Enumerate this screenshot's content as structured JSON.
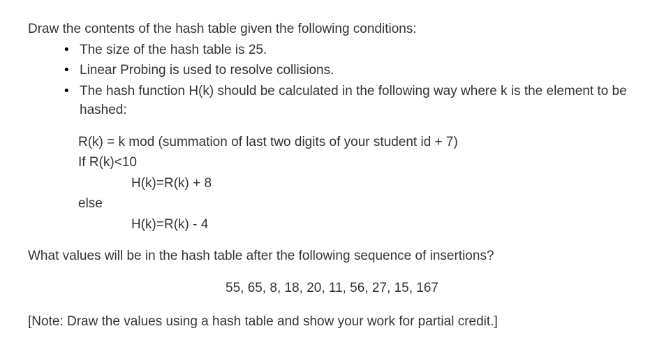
{
  "intro": "Draw the contents of the hash table given the following conditions:",
  "bullets": [
    "The size of the hash table is 25.",
    "Linear Probing is used to resolve collisions.",
    "The hash function H(k) should be calculated in the following way where k is the element to be hashed:"
  ],
  "formula": {
    "line1": "R(k) = k mod (summation of last two digits of your student id + 7)",
    "line2": "If R(k)<10",
    "line3": "H(k)=R(k) + 8",
    "line4": "else",
    "line5": "H(k)=R(k) - 4"
  },
  "question": "What values will be in the hash table after the following sequence of insertions?",
  "sequence": "55, 65, 8, 18, 20, 11, 56, 27, 15, 167",
  "note": "[Note: Draw the values using a hash table and show your work for partial credit.]"
}
